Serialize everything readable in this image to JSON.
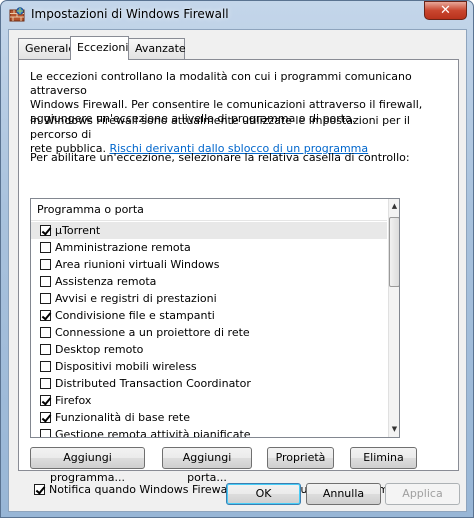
{
  "window": {
    "title": "Impostazioni di Windows Firewall",
    "close_label": "✕"
  },
  "tabs": [
    {
      "label": "Generale",
      "active": false
    },
    {
      "label": "Eccezioni",
      "active": true
    },
    {
      "label": "Avanzate",
      "active": false
    }
  ],
  "panel": {
    "desc1_line1": "Le eccezioni controllano la modalità con cui i programmi comunicano attraverso",
    "desc1_line2": "Windows Firewall. Per consentire le comunicazioni attraverso il firewall,",
    "desc1_line3": "aggiungere un'eccezione a livello di programma o di porta.",
    "desc2_line1": "In Windows Firewall sono attualmente utilizzate le impostazioni per il percorso di",
    "desc2_line2": "rete pubblica.",
    "risk_link": "Rischi derivanti dallo sblocco di un programma",
    "instruction": "Per abilitare un'eccezione, selezionare la relativa casella di controllo:"
  },
  "list": {
    "header": "Programma o porta",
    "items": [
      {
        "label": "µTorrent",
        "checked": true,
        "selected": true
      },
      {
        "label": "Amministrazione remota",
        "checked": false
      },
      {
        "label": "Area riunioni virtuali Windows",
        "checked": false
      },
      {
        "label": "Assistenza remota",
        "checked": false
      },
      {
        "label": "Avvisi e registri di prestazioni",
        "checked": false
      },
      {
        "label": "Condivisione file e stampanti",
        "checked": true
      },
      {
        "label": "Connessione a un proiettore di rete",
        "checked": false
      },
      {
        "label": "Desktop remoto",
        "checked": false
      },
      {
        "label": "Dispositivi mobili wireless",
        "checked": false
      },
      {
        "label": "Distributed Transaction Coordinator",
        "checked": false
      },
      {
        "label": "Firefox",
        "checked": true
      },
      {
        "label": "Funzionalità di base rete",
        "checked": true
      },
      {
        "label": "Gestione remota attività pianificate",
        "checked": false
      }
    ]
  },
  "buttons": {
    "add_program": "Aggiungi programma...",
    "add_port": "Aggiungi porta...",
    "properties": "Proprietà",
    "delete": "Elimina",
    "ok": "OK",
    "cancel": "Annulla",
    "apply": "Applica"
  },
  "notify": {
    "label": "Notifica quando Windows Firewall blocca un nuovo programma",
    "checked": true
  }
}
